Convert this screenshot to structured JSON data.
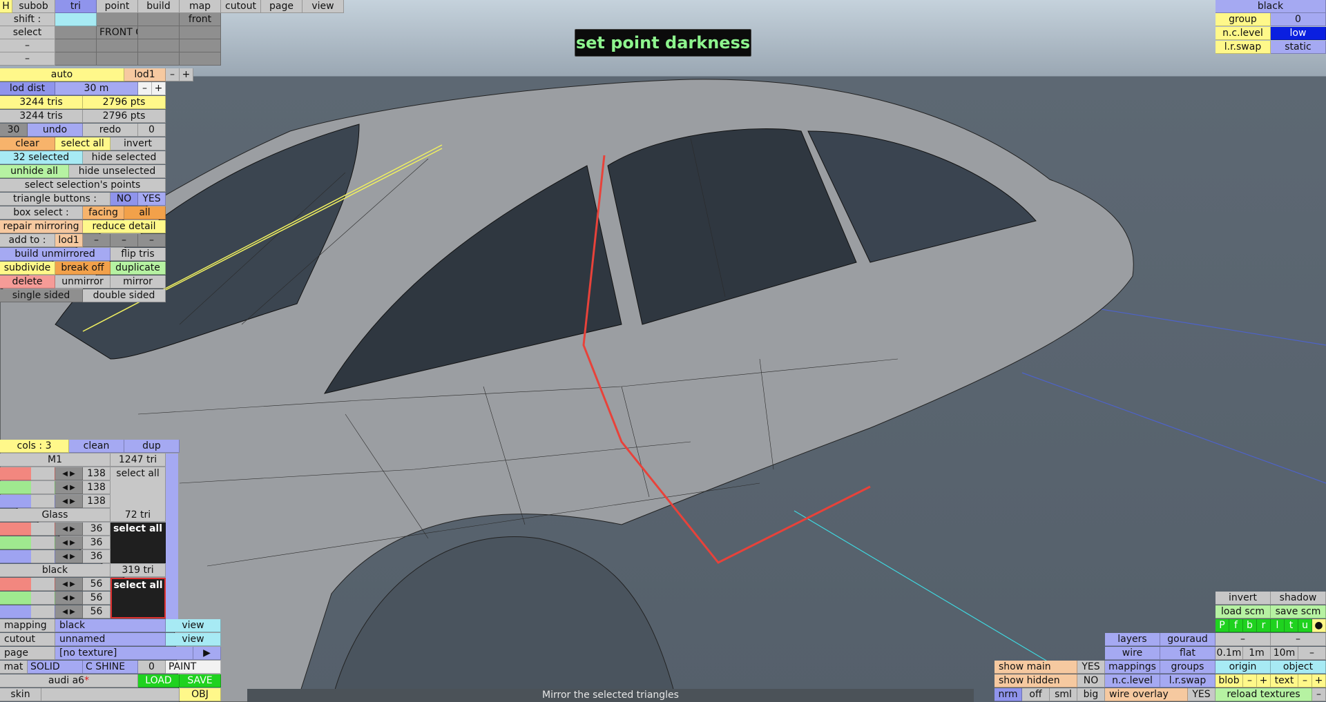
{
  "overlay_title": "set point darkness",
  "status_text": "Mirror the selected triangles",
  "top_menu": {
    "h": "H",
    "subob": "subob",
    "tri": "tri",
    "point": "point",
    "build": "build",
    "map": "map",
    "cutout": "cutout",
    "page": "page",
    "view": "view"
  },
  "row2": {
    "shift": "shift :",
    "front": "front"
  },
  "row3": {
    "select": "select",
    "front_g": "FRONT G"
  },
  "row4": {
    "dash1": "–",
    "dash2": "–"
  },
  "lod": {
    "auto": "auto",
    "lod1": "lod1",
    "minus": "–",
    "plus": "+"
  },
  "lod_dist": {
    "label": "lod dist",
    "value": "30 m",
    "minus": "–",
    "plus": "+"
  },
  "counts": {
    "tris1": "3244 tris",
    "pts1": "2796 pts",
    "tris2": "3244 tris",
    "pts2": "2796 pts"
  },
  "undo_row": {
    "left": "30",
    "undo": "undo",
    "redo": "redo",
    "right": "0"
  },
  "sel_row": {
    "clear": "clear",
    "select_all": "select all",
    "invert": "invert"
  },
  "selected_row": {
    "selected": "32 selected",
    "hide": "hide selected"
  },
  "unhide_row": {
    "unhide": "unhide all",
    "hide_unsel": "hide unselected"
  },
  "sel_points": "select selection's points",
  "tri_buttons": {
    "label": "triangle buttons :",
    "no": "NO",
    "yes": "YES"
  },
  "box_select": {
    "label": "box select :",
    "facing": "facing",
    "all": "all"
  },
  "repair_row": {
    "repair": "repair mirroring",
    "reduce": "reduce detail"
  },
  "add_to": {
    "label": "add to :",
    "lod1": "lod1",
    "d1": "–",
    "d2": "–",
    "d3": "–"
  },
  "build_row": {
    "build": "build unmirrored",
    "flip": "flip tris"
  },
  "sub_row": {
    "subdivide": "subdivide",
    "break": "break off",
    "duplicate": "duplicate"
  },
  "del_row": {
    "delete": "delete",
    "unmirror": "unmirror",
    "mirror": "mirror"
  },
  "sided_row": {
    "single": "single sided",
    "double": "double sided"
  },
  "materials_header": {
    "cols": "cols : 3",
    "clean": "clean",
    "dup": "dup"
  },
  "materials": [
    {
      "name": "M1",
      "tri": "1247 tri",
      "values": [
        "138",
        "138",
        "138"
      ],
      "select": "select all"
    },
    {
      "name": "Glass",
      "tri": "72 tri",
      "values": [
        "36",
        "36",
        "36"
      ],
      "select": "select all"
    },
    {
      "name": "black",
      "tri": "319 tri",
      "values": [
        "56",
        "56",
        "56"
      ],
      "select": "select all"
    }
  ],
  "bottom_left": {
    "mapping": "mapping",
    "mapping_val": "black",
    "view1": "view",
    "cutout": "cutout",
    "cutout_val": "unnamed",
    "view2": "view",
    "page": "page",
    "page_val": "[no texture]",
    "page_arrow": "▶",
    "mat": "mat",
    "solid": "SOLID",
    "cshine": "C SHINE",
    "zero": "0",
    "paint": "PAINT",
    "file": "audi a6",
    "star": "*",
    "load": "LOAD",
    "save": "SAVE",
    "skin": "skin",
    "obj": "OBJ"
  },
  "top_right": {
    "title": "black",
    "group": "group",
    "group_val": "0",
    "nclevel": "n.c.level",
    "nclevel_val": "low",
    "lrswap": "l.r.swap",
    "lrswap_val": "static"
  },
  "bottom_right": {
    "invert": "invert",
    "shadow": "shadow",
    "load_scm": "load scm",
    "save_scm": "save scm",
    "letters": [
      "P",
      "f",
      "b",
      "r",
      "l",
      "t",
      "u",
      "●"
    ],
    "layers": "layers",
    "gouraud": "gouraud",
    "dash_a": "–",
    "dash_b": "–",
    "wire": "wire",
    "flat": "flat",
    "s01": "0.1m",
    "s1": "1m",
    "s10": "10m",
    "sdash": "–",
    "show_main": "show main",
    "show_main_val": "YES",
    "mappings": "mappings",
    "groups": "groups",
    "origin": "origin",
    "object": "object",
    "show_hidden": "show hidden",
    "show_hidden_val": "NO",
    "nclevel": "n.c.level",
    "lrswap": "l.r.swap",
    "blob": "blob",
    "bm": "–",
    "bp": "+",
    "text": "text",
    "tm": "–",
    "tp": "+",
    "nrm": "nrm",
    "off": "off",
    "sml": "sml",
    "big": "big",
    "wire_overlay": "wire overlay",
    "wire_overlay_val": "YES",
    "reload": "reload textures",
    "rdash": "–"
  },
  "colors": {
    "gray": "#c7c7c7",
    "blue": "#a5a9f2",
    "yellow": "#fff88a",
    "orange": "#f7b36b",
    "green": "#b6f2a2",
    "cyan": "#a7eaf4",
    "pink": "#f59b97",
    "selection_line": "#e8423a"
  }
}
